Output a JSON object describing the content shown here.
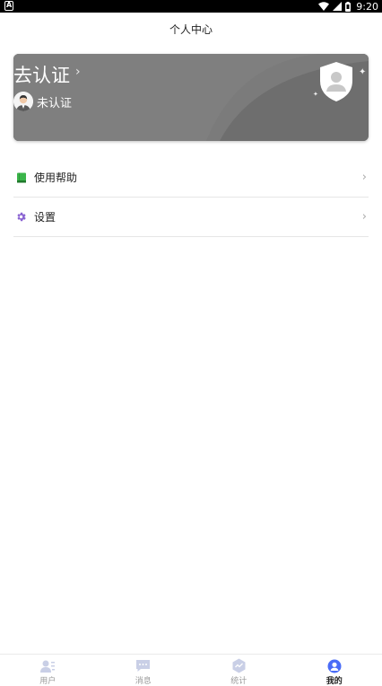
{
  "status_bar": {
    "time": "9:20"
  },
  "header": {
    "title": "个人中心"
  },
  "card": {
    "title": "去认证",
    "status": "未认证"
  },
  "menu": [
    {
      "label": "使用帮助",
      "icon": "book-icon",
      "color": "#3bb54a"
    },
    {
      "label": "设置",
      "icon": "gear-icon",
      "color": "#8a63d2"
    }
  ],
  "bottom_nav": [
    {
      "label": "用户",
      "icon": "user-list-icon",
      "active": false
    },
    {
      "label": "消息",
      "icon": "message-icon",
      "active": false
    },
    {
      "label": "统计",
      "icon": "stats-icon",
      "active": false
    },
    {
      "label": "我的",
      "icon": "profile-icon",
      "active": true
    }
  ],
  "colors": {
    "accent": "#4a6cf7",
    "card_bg": "#6f6f6f"
  }
}
